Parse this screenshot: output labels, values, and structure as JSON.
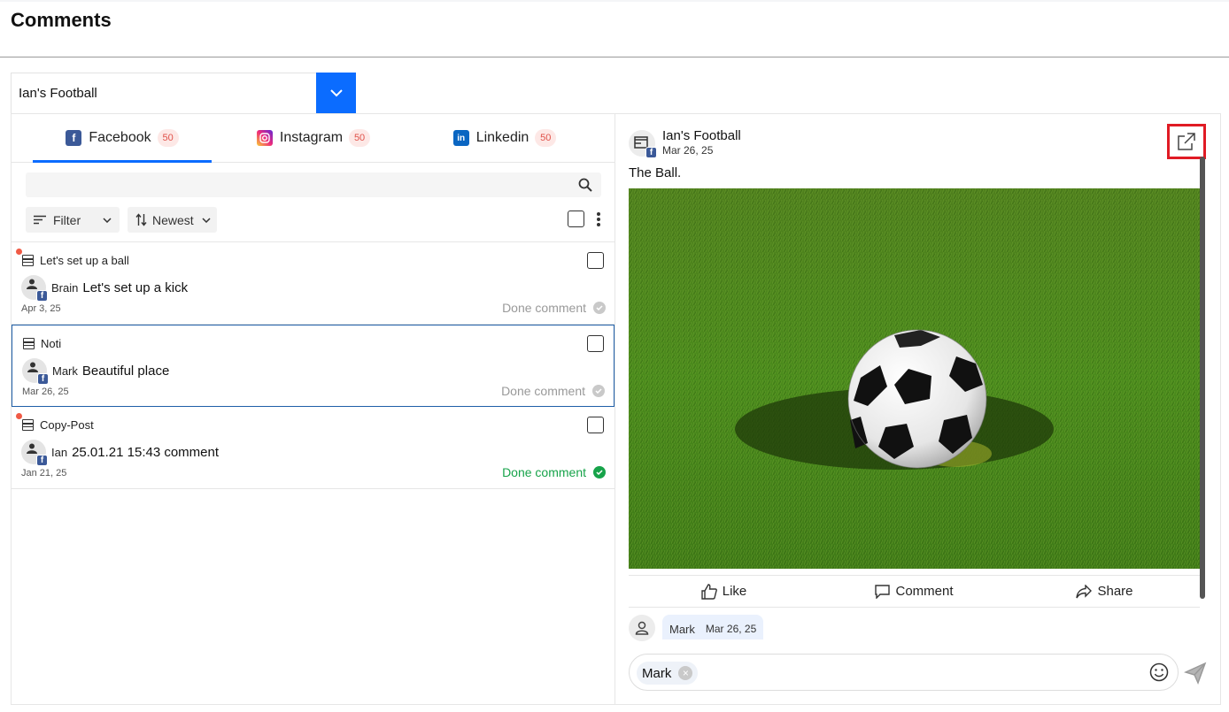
{
  "page": {
    "title": "Comments"
  },
  "page_select": {
    "value": "Ian's Football"
  },
  "tabs": [
    {
      "label": "Facebook",
      "count": "50",
      "icon": "facebook-icon",
      "color": "#3b5998",
      "active": true
    },
    {
      "label": "Instagram",
      "count": "50",
      "icon": "instagram-icon",
      "color": "#d6249f",
      "active": false
    },
    {
      "label": "Linkedin",
      "count": "50",
      "icon": "linkedin-icon",
      "color": "#0a66c2",
      "active": false
    }
  ],
  "search": {
    "placeholder": ""
  },
  "controls": {
    "filter_label": "Filter",
    "sort_label": "Newest"
  },
  "comments": [
    {
      "post_title": "Let's set up a ball",
      "author": "Brain",
      "message": "Let's set up a kick",
      "date": "Apr 3, 25",
      "status": "Done comment",
      "unread": true,
      "done": false
    },
    {
      "post_title": "Noti",
      "author": "Mark",
      "message": "Beautiful place",
      "date": "Mar 26, 25",
      "status": "Done comment",
      "unread": false,
      "done": false
    },
    {
      "post_title": "Copy-Post",
      "author": "Ian",
      "message": "25.01.21 15:43 comment",
      "date": "Jan 21, 25",
      "status": "Done comment",
      "unread": true,
      "done": true
    }
  ],
  "post": {
    "page_name": "Ian's Football",
    "date": "Mar 26, 25",
    "text": "The Ball.",
    "actions": {
      "like": "Like",
      "comment": "Comment",
      "share": "Share"
    }
  },
  "thread": {
    "author": "Mark",
    "date": "Mar 26, 25"
  },
  "reply": {
    "mention": "Mark"
  },
  "colors": {
    "accent": "#0b6cff",
    "done": "#17a34a",
    "badge_bg": "#fde8e6",
    "badge_text": "#e0524a",
    "highlight": "#e01b24"
  }
}
